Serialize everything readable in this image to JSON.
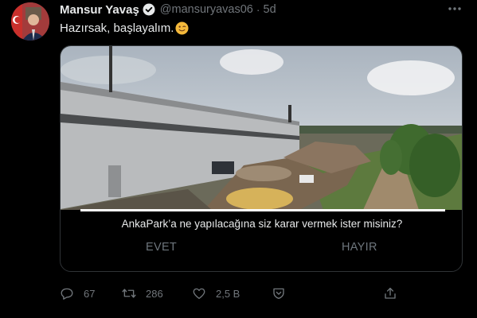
{
  "tweet": {
    "author_name": "Mansur Yavaş",
    "handle": "@mansuryavas06",
    "separator": "·",
    "time": "5d",
    "text": "Hazırsak, başlayalım.",
    "emoji": "winking-face"
  },
  "media": {
    "question": "AnkaPark’a ne yapılacağına siz karar vermek ister misiniz?",
    "option_yes": "EVET",
    "option_no": "HAYIR",
    "progress": 1.0
  },
  "actions": {
    "replies": "67",
    "retweets": "286",
    "likes": "2,5 B"
  },
  "colors": {
    "background": "#000000",
    "text": "#e7e9ea",
    "muted": "#71767b",
    "verified": "#1d9bf0"
  }
}
